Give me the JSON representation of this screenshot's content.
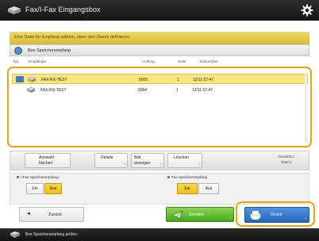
{
  "header": {
    "title": "Fax/I-Fax Eingangsbox"
  },
  "banner": "Eine Datei für Empfang wählen, dann den Zweck definieren.",
  "subheader": "Box Speicherempfang",
  "columns": [
    "Typ",
    "Empfänger",
    "Auftrag",
    "Seite",
    "Datum/Zeit"
  ],
  "rows": [
    {
      "recipient": "FAX-RX-TEST",
      "job": "5005",
      "pages": "1",
      "datetime": "12/11 07:47",
      "selected": true
    },
    {
      "recipient": "FAX-RX-TEST",
      "job": "5004",
      "pages": "1",
      "datetime": "12/11 07:47",
      "selected": false
    }
  ],
  "toolbar": {
    "deselect": [
      "Auswahl",
      "löschen"
    ],
    "details": "Details",
    "preview": [
      "Bild",
      "anzeigen"
    ],
    "delete": "Löschen",
    "count": [
      "Gewählt:1",
      "Total:2"
    ]
  },
  "options": {
    "ifax": {
      "label": "I-Fax Speicherempfang",
      "off": "Ein",
      "on": "Aus",
      "active": "Aus"
    },
    "fax": {
      "label": "Fax Speicherempfang",
      "off": "Ein",
      "on": "Aus",
      "active": "Ein"
    }
  },
  "buttons": {
    "back": "Zurück",
    "send": "Senden",
    "print": "Druck"
  },
  "footer": "Box Speicherempfang prüfen.",
  "colors": {
    "accent": "#f3a200",
    "selected_row": "#fbe57f",
    "banner": "#e5c44d",
    "print_button": "#3a7ccf",
    "send_button": "#5cba2f"
  },
  "icons": [
    "fax-logo-icon",
    "gear-icon",
    "box-icon",
    "fax-document-icon",
    "checkbox-icon",
    "arrow-left-icon",
    "send-icon",
    "print-icon"
  ]
}
